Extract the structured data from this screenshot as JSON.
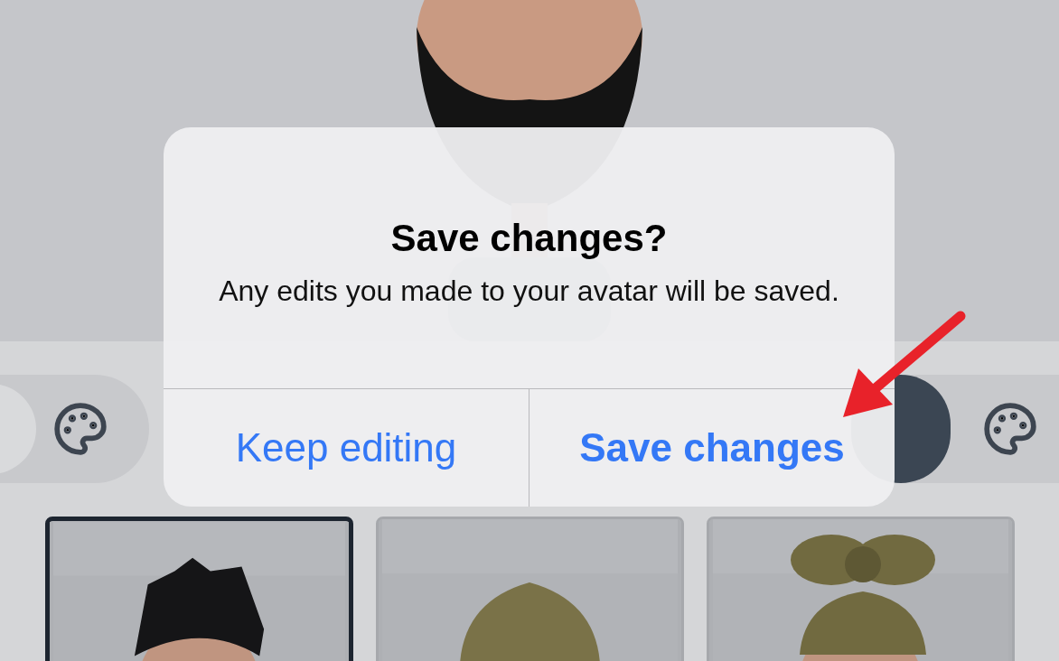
{
  "dialog": {
    "title": "Save changes?",
    "message": "Any edits you made to your avatar will be saved.",
    "buttons": [
      {
        "label": "Keep editing",
        "kind": "default"
      },
      {
        "label": "Save changes",
        "kind": "bold"
      }
    ]
  },
  "items": [
    {
      "selected": true
    },
    {
      "selected": false
    },
    {
      "selected": false
    }
  ]
}
